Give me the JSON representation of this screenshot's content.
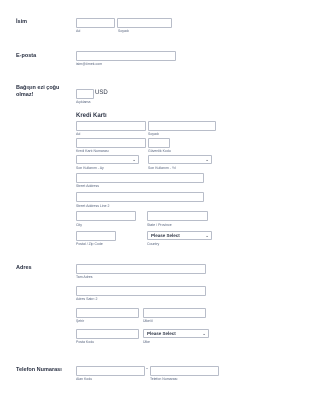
{
  "name": {
    "label": "İsim",
    "first_sub": "Ad",
    "last_sub": "Soyadı"
  },
  "email": {
    "label": "E-posta",
    "sub": "isim@örnek.com"
  },
  "donation": {
    "label": "Bağışın ezi çoğu olmaz!",
    "currency": "USD",
    "sub": "Açıklama"
  },
  "card": {
    "title": "Kredi Kartı",
    "first_sub": "Ad",
    "last_sub": "Soyadı",
    "number_sub": "Kredi Kartı Numarası",
    "cvv_sub": "Güvenlik Kodu",
    "month_sub": "Son Kullanım - Ay",
    "year_sub": "Son Kullanım - Yıl",
    "street_sub": "Street Address",
    "street2_sub": "Street Address Line 2",
    "city_sub": "City",
    "state_sub": "State / Province",
    "postal_sub": "Postal / Zip Code",
    "country_sub": "Country",
    "country_value": "Please Select"
  },
  "address": {
    "label": "Adres",
    "line1_sub": "Tam Adres",
    "line2_sub": "Adres Satırı 2",
    "city_sub": "Şehir",
    "state_sub": "Ülke/il",
    "postal_sub": "Posta Kodu",
    "country_sub": "Ülke",
    "country_value": "Please Select"
  },
  "phone": {
    "label": "Telefon Numarası",
    "area_sub": "Alan Kodu",
    "number_sub": "Telefon Numarası",
    "separator": "-"
  },
  "icons": {
    "dropdown": "chevron-down-icon"
  }
}
